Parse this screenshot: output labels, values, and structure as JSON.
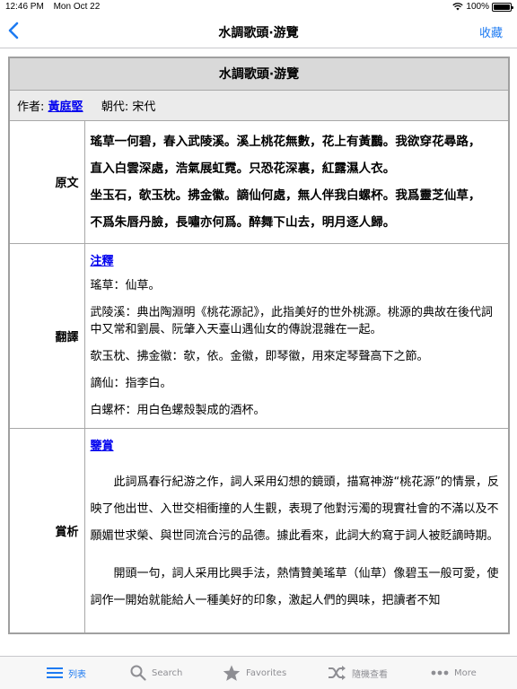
{
  "status": {
    "time": "12:46 PM",
    "date": "Mon Oct 22",
    "battery": "100%",
    "battery_level": 1.0
  },
  "nav": {
    "title": "水調歌頭·游覽",
    "action": "收藏"
  },
  "poem": {
    "title": "水調歌頭·游覽",
    "author_label": "作者:",
    "author": "黃庭堅",
    "dynasty_label": "朝代:",
    "dynasty": "宋代",
    "original_label": "原文",
    "original_lines": [
      "瑤草一何碧，春入武陵溪。溪上桃花無數，花上有黃鸝。我欲穿花尋路，",
      "直入白雲深處，浩氣展虹霓。只恐花深裏，紅露濕人衣。",
      "坐玉石，欹玉枕。拂金徽。謫仙何處，無人伴我白螺杯。我爲靈芝仙草，",
      "不爲朱唇丹臉，長嘯亦何爲。醉舞下山去，明月逐人歸。"
    ],
    "translation_label": "翻譯",
    "notes_title": "注釋",
    "notes": [
      "瑤草：仙草。",
      "武陵溪：典出陶淵明《桃花源記》，此指美好的世外桃源。桃源的典故在後代詞中又常和劉晨、阮肇入天臺山遇仙女的傳說混雜在一起。",
      "欹玉枕、拂金徽：欹，依。金徽，即琴徽，用來定琴聲高下之節。",
      "謫仙：指李白。",
      "白螺杯：用白色螺殼製成的酒杯。"
    ],
    "appreciation_label": "賞析",
    "appreciation_title": "鑒賞",
    "appreciation": [
      "此詞爲春行紀游之作，詞人采用幻想的鏡頭，描寫神游“桃花源”的情景，反映了他出世、入世交相衝撞的人生觀，表現了他對污濁的現實社會的不滿以及不願媚世求榮、與世同流合污的品德。據此看來，此詞大約寫于詞人被貶謫時期。",
      "開頭一句，詞人采用比興手法，熱情贊美瑤草（仙草）像碧玉一般可愛，使詞作一開始就能給人一種美好的印象，激起人們的興味，把讀者不知"
    ]
  },
  "tabs": [
    {
      "label": "列表",
      "icon": "list-icon",
      "active": true
    },
    {
      "label": "Search",
      "icon": "search-icon",
      "active": false
    },
    {
      "label": "Favorites",
      "icon": "star-icon",
      "active": false
    },
    {
      "label": "隨機查看",
      "icon": "shuffle-icon",
      "active": false
    },
    {
      "label": "More",
      "icon": "more-icon",
      "active": false
    }
  ],
  "colors": {
    "accent": "#1e7bf2",
    "link": "#0000ee",
    "header_bg": "#d9d9d9",
    "author_bg": "#ebebeb"
  }
}
